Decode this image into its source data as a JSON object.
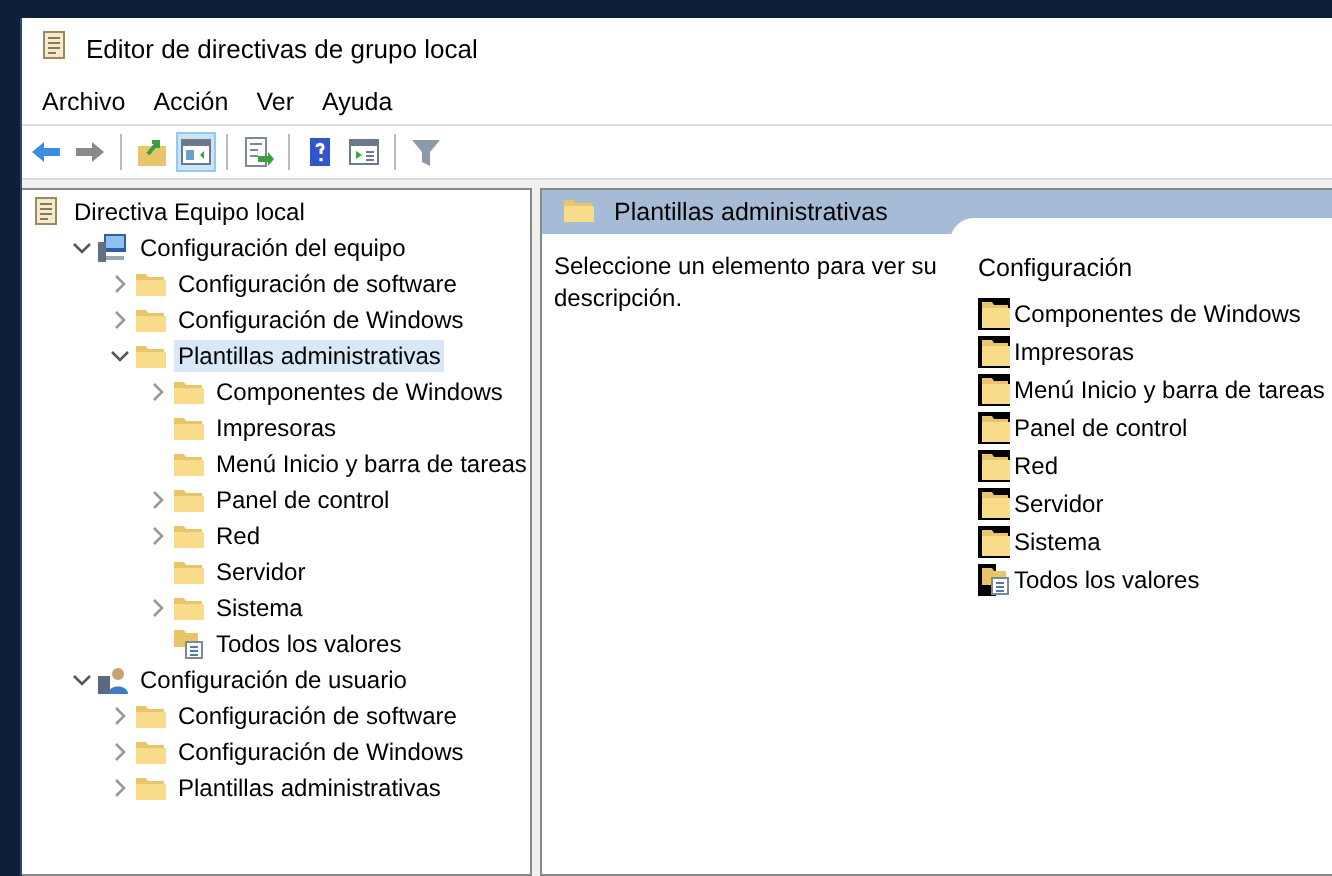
{
  "window": {
    "title": "Editor de directivas de grupo local"
  },
  "menu": [
    "Archivo",
    "Acción",
    "Ver",
    "Ayuda"
  ],
  "toolbar": [
    {
      "kind": "back",
      "selected": false
    },
    {
      "kind": "forward",
      "selected": false
    },
    {
      "kind": "sep"
    },
    {
      "kind": "up",
      "selected": false
    },
    {
      "kind": "tree",
      "selected": true
    },
    {
      "kind": "sep"
    },
    {
      "kind": "export",
      "selected": false
    },
    {
      "kind": "sep"
    },
    {
      "kind": "help",
      "selected": false
    },
    {
      "kind": "pane",
      "selected": false
    },
    {
      "kind": "sep"
    },
    {
      "kind": "filter",
      "selected": false
    }
  ],
  "tree": [
    {
      "label": "Directiva Equipo local",
      "kind": "policy",
      "selected": false,
      "children": [
        {
          "label": "Configuración del equipo",
          "kind": "computer",
          "expanded": true,
          "selected": false,
          "children": [
            {
              "label": "Configuración de software",
              "kind": "folder",
              "expanded": false,
              "selected": false
            },
            {
              "label": "Configuración de Windows",
              "kind": "folder",
              "expanded": false,
              "selected": false
            },
            {
              "label": "Plantillas administrativas",
              "kind": "folder",
              "expanded": true,
              "selected": true,
              "children": [
                {
                  "label": "Componentes de Windows",
                  "kind": "folder",
                  "expanded": false,
                  "selected": false
                },
                {
                  "label": "Impresoras",
                  "kind": "folder",
                  "selected": false
                },
                {
                  "label": "Menú Inicio y barra de tareas",
                  "kind": "folder",
                  "selected": false
                },
                {
                  "label": "Panel de control",
                  "kind": "folder",
                  "expanded": false,
                  "selected": false
                },
                {
                  "label": "Red",
                  "kind": "folder",
                  "expanded": false,
                  "selected": false
                },
                {
                  "label": "Servidor",
                  "kind": "folder",
                  "selected": false
                },
                {
                  "label": "Sistema",
                  "kind": "folder",
                  "expanded": false,
                  "selected": false
                },
                {
                  "label": "Todos los valores",
                  "kind": "settings",
                  "selected": false
                }
              ]
            }
          ]
        },
        {
          "label": "Configuración de usuario",
          "kind": "user",
          "expanded": true,
          "selected": false,
          "children": [
            {
              "label": "Configuración de software",
              "kind": "folder",
              "expanded": false,
              "selected": false
            },
            {
              "label": "Configuración de Windows",
              "kind": "folder",
              "expanded": false,
              "selected": false
            },
            {
              "label": "Plantillas administrativas",
              "kind": "folder",
              "expanded": false,
              "selected": false
            }
          ]
        }
      ]
    }
  ],
  "details": {
    "title": "Plantillas administrativas",
    "description": "Seleccione un elemento para ver su descripción.",
    "column": "Configuración",
    "items": [
      {
        "label": "Componentes de Windows",
        "kind": "folder"
      },
      {
        "label": "Impresoras",
        "kind": "folder"
      },
      {
        "label": "Menú Inicio y barra de tareas",
        "kind": "folder"
      },
      {
        "label": "Panel de control",
        "kind": "folder"
      },
      {
        "label": "Red",
        "kind": "folder"
      },
      {
        "label": "Servidor",
        "kind": "folder"
      },
      {
        "label": "Sistema",
        "kind": "folder"
      },
      {
        "label": "Todos los valores",
        "kind": "settings"
      }
    ]
  }
}
